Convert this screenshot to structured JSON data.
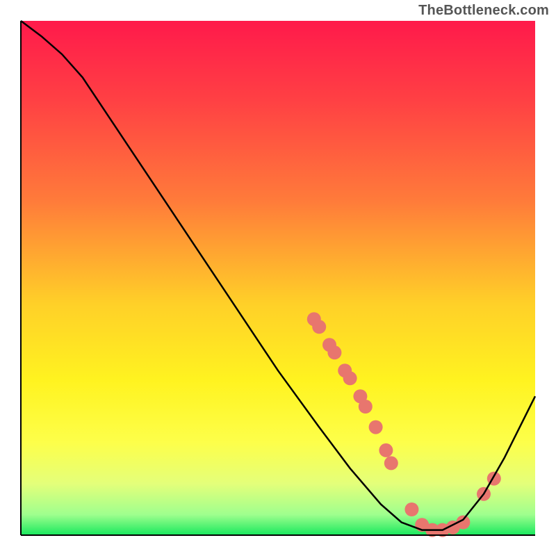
{
  "watermark": "TheBottleneck.com",
  "chart_data": {
    "type": "line",
    "title": "",
    "xlabel": "",
    "ylabel": "",
    "xlim": [
      0,
      100
    ],
    "ylim": [
      0,
      100
    ],
    "gradient_stops": [
      {
        "offset": 0,
        "color": "#ff1a4b"
      },
      {
        "offset": 15,
        "color": "#ff3f44"
      },
      {
        "offset": 35,
        "color": "#ff7b3a"
      },
      {
        "offset": 55,
        "color": "#ffd028"
      },
      {
        "offset": 70,
        "color": "#fff320"
      },
      {
        "offset": 82,
        "color": "#fdff4a"
      },
      {
        "offset": 90,
        "color": "#e4ff7a"
      },
      {
        "offset": 96,
        "color": "#9fff8e"
      },
      {
        "offset": 100,
        "color": "#19e85e"
      }
    ],
    "series": [
      {
        "name": "bottleneck-curve",
        "color": "#000000",
        "x": [
          0,
          4,
          8,
          12,
          16,
          22,
          30,
          40,
          50,
          58,
          64,
          70,
          74,
          78,
          82,
          86,
          90,
          94,
          98,
          100
        ],
        "y": [
          100,
          97,
          93.5,
          89,
          83,
          74,
          62,
          47,
          32,
          21,
          13,
          6,
          2.5,
          1,
          1,
          3,
          8,
          15,
          23,
          27
        ]
      }
    ],
    "markers": {
      "name": "highlighted-points",
      "color": "#e8766e",
      "radius": 10,
      "points": [
        {
          "x": 57,
          "y": 42
        },
        {
          "x": 58,
          "y": 40.5
        },
        {
          "x": 60,
          "y": 37
        },
        {
          "x": 61,
          "y": 35.5
        },
        {
          "x": 63,
          "y": 32
        },
        {
          "x": 64,
          "y": 30.5
        },
        {
          "x": 66,
          "y": 27
        },
        {
          "x": 67,
          "y": 25
        },
        {
          "x": 69,
          "y": 21
        },
        {
          "x": 71,
          "y": 16.5
        },
        {
          "x": 72,
          "y": 14
        },
        {
          "x": 76,
          "y": 5
        },
        {
          "x": 78,
          "y": 2
        },
        {
          "x": 80,
          "y": 1
        },
        {
          "x": 82,
          "y": 1
        },
        {
          "x": 84,
          "y": 1.5
        },
        {
          "x": 86,
          "y": 2.5
        },
        {
          "x": 90,
          "y": 8
        },
        {
          "x": 92,
          "y": 11
        }
      ]
    }
  }
}
